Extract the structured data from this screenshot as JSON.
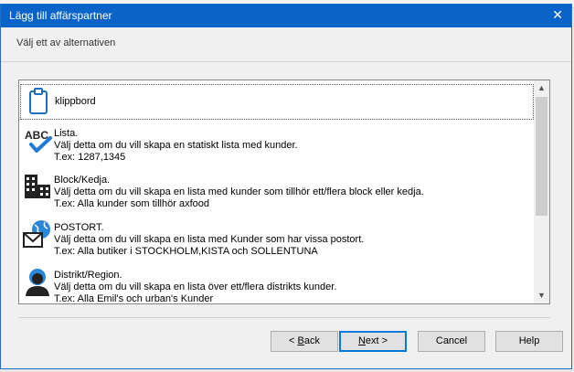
{
  "dialog": {
    "title": "Lägg till affärspartner",
    "close_glyph": "✕",
    "instruction": "Välj ett av alternativen"
  },
  "options": [
    {
      "icon": "clipboard-icon",
      "lines": [
        "klippbord"
      ]
    },
    {
      "icon": "spellcheck-abc-icon",
      "lines": [
        "Lista.",
        "Välj detta om du vill skapa en statiskt lista med kunder.",
        "T.ex: 1287,1345"
      ]
    },
    {
      "icon": "buildings-icon",
      "lines": [
        "Block/Kedja.",
        "Välj detta om du vill skapa en lista med kunder som tillhör ett/flera block eller kedja.",
        "T.ex: Alla kunder som tillhör axfood"
      ]
    },
    {
      "icon": "globe-mail-icon",
      "lines": [
        "POSTORT.",
        "Välj detta om du vill skapa en lista med Kunder som har vissa postort.",
        "T.ex: Alla butiker i STOCKHOLM,KISTA och SOLLENTUNA"
      ]
    },
    {
      "icon": "user-icon",
      "lines": [
        "Distrikt/Region.",
        "Välj detta om du vill skapa en lista över ett/flera distrikts kunder.",
        "T.ex: Alla Emil's  och urban's Kunder"
      ]
    }
  ],
  "buttons": {
    "back_underlined": "B",
    "back_rest": "ack",
    "back_prefix": "< ",
    "next_underlined": "N",
    "next_rest": "ext >",
    "cancel": "Cancel",
    "help": "Help"
  }
}
